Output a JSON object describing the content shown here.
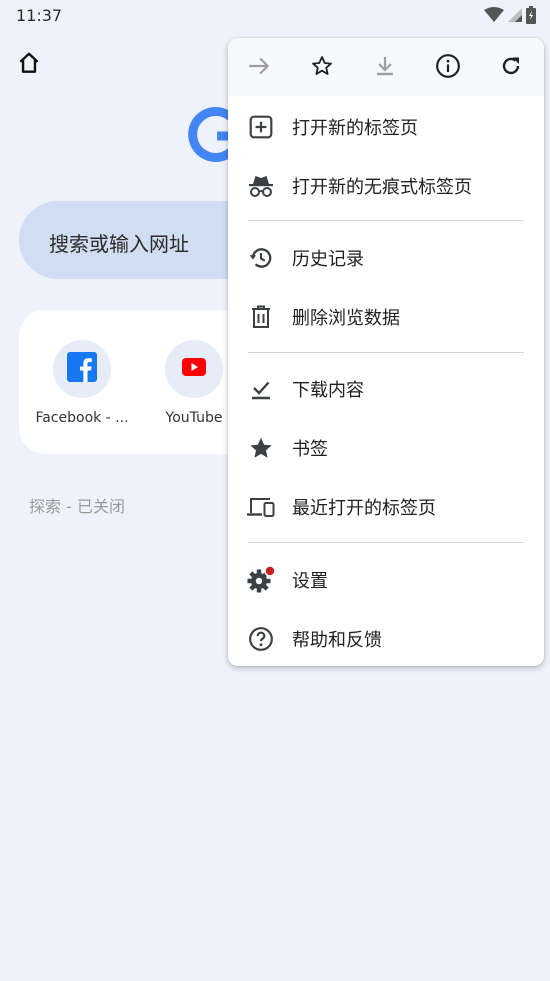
{
  "status_bar": {
    "time": "11:37",
    "icons": [
      "wifi-icon",
      "signal-icon",
      "battery-icon"
    ]
  },
  "toolbar": {
    "home_icon": "home-icon"
  },
  "search": {
    "placeholder": "搜索或输入网址"
  },
  "shortcuts": [
    {
      "label": "Facebook - ...",
      "icon": "facebook-icon"
    },
    {
      "label": "YouTube",
      "icon": "youtube-icon"
    }
  ],
  "discover": {
    "label": "探索 - 已关闭"
  },
  "menu": {
    "toolbar_icons": [
      "forward-icon",
      "bookmark-star-icon",
      "download-icon",
      "info-icon",
      "reload-icon"
    ],
    "items": [
      {
        "label": "打开新的标签页",
        "icon": "new-tab-icon"
      },
      {
        "label": "打开新的无痕式标签页",
        "icon": "incognito-icon"
      },
      {
        "label": "历史记录",
        "icon": "history-icon"
      },
      {
        "label": "删除浏览数据",
        "icon": "trash-icon"
      },
      {
        "label": "下载内容",
        "icon": "downloads-icon"
      },
      {
        "label": "书签",
        "icon": "star-icon"
      },
      {
        "label": "最近打开的标签页",
        "icon": "recent-tabs-icon"
      },
      {
        "label": "设置",
        "icon": "settings-icon"
      },
      {
        "label": "帮助和反馈",
        "icon": "help-icon"
      }
    ]
  },
  "colors": {
    "page_background": "#f0f2fb",
    "search_box": "#d1ddf2",
    "menu_background": "#ffffff",
    "icon_dark": "#3c4043",
    "settings_badge": "#c5221f",
    "facebook_blue": "#1877f2",
    "youtube_red": "#ff0000"
  }
}
